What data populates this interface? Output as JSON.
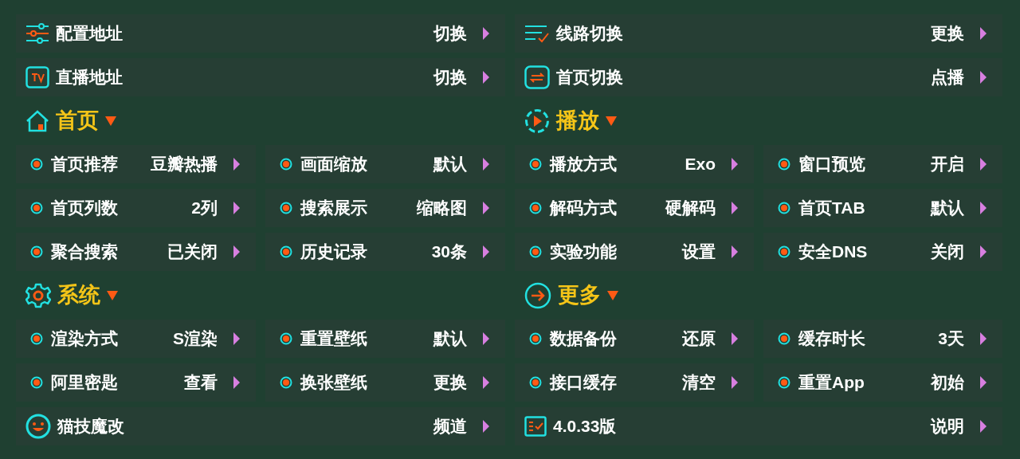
{
  "top_items": [
    {
      "label": "配置地址",
      "value": "切换"
    },
    {
      "label": "线路切换",
      "value": "更换"
    },
    {
      "label": "直播地址",
      "value": "切换"
    },
    {
      "label": "首页切换",
      "value": "点播"
    }
  ],
  "sections": [
    {
      "title": "首页",
      "items": [
        {
          "label": "首页推荐",
          "value": "豆瓣热播"
        },
        {
          "label": "画面缩放",
          "value": "默认"
        },
        {
          "label": "首页列数",
          "value": "2列"
        },
        {
          "label": "搜索展示",
          "value": "缩略图"
        },
        {
          "label": "聚合搜索",
          "value": "已关闭"
        },
        {
          "label": "历史记录",
          "value": "30条"
        }
      ]
    },
    {
      "title": "播放",
      "items": [
        {
          "label": "播放方式",
          "value": "Exo"
        },
        {
          "label": "窗口预览",
          "value": "开启"
        },
        {
          "label": "解码方式",
          "value": "硬解码"
        },
        {
          "label": "首页TAB",
          "value": "默认"
        },
        {
          "label": "实验功能",
          "value": "设置"
        },
        {
          "label": "安全DNS",
          "value": "关闭"
        }
      ]
    },
    {
      "title": "系统",
      "items": [
        {
          "label": "渲染方式",
          "value": "S渲染"
        },
        {
          "label": "重置壁纸",
          "value": "默认"
        },
        {
          "label": "阿里密匙",
          "value": "查看"
        },
        {
          "label": "换张壁纸",
          "value": "更换"
        }
      ]
    },
    {
      "title": "更多",
      "items": [
        {
          "label": "数据备份",
          "value": "还原"
        },
        {
          "label": "缓存时长",
          "value": "3天"
        },
        {
          "label": "接口缓存",
          "value": "清空"
        },
        {
          "label": "重置App",
          "value": "初始"
        }
      ]
    }
  ],
  "bottom_items": [
    {
      "label": "猫技魔改",
      "value": "频道"
    },
    {
      "label": "4.0.33版",
      "value": "说明"
    }
  ]
}
